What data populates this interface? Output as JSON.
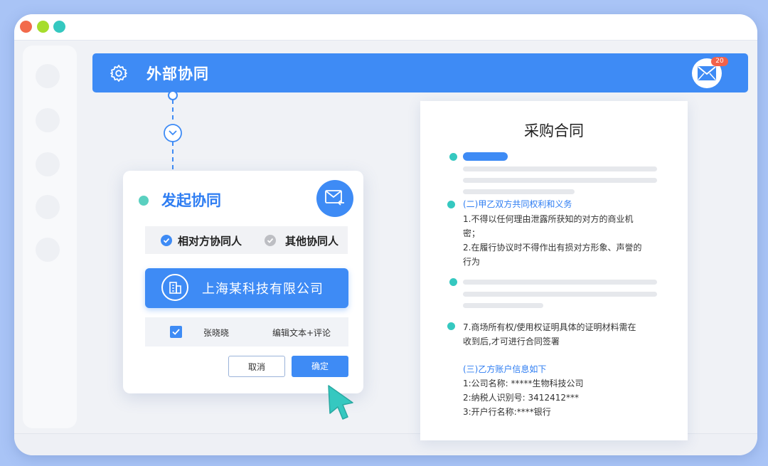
{
  "window": {
    "traffic_lights": [
      "#f26a4b",
      "#a6dd2c",
      "#35c8c0"
    ]
  },
  "topbar": {
    "title": "外部协同",
    "icon": "gear-icon",
    "mail_badge": "20"
  },
  "modal": {
    "title": "发起协同",
    "tabs": [
      {
        "label": "相对方协同人",
        "checked": true
      },
      {
        "label": "其他协同人",
        "checked": false
      }
    ],
    "company": "上海某科技有限公司",
    "member": {
      "name": "张晓晓",
      "permission": "编辑文本+评论",
      "checked": true
    },
    "cancel_label": "取消",
    "confirm_label": "确定"
  },
  "document": {
    "title": "采购合同",
    "section2_heading": "(二)甲乙双方共同权利和义务",
    "section2_line1": "1.不得以任何理由泄露所获知的对方的商业机",
    "section2_line1b": "密；",
    "section2_line2": "2.在履行协议时不得作出有损对方形象、声誉的",
    "section2_line2b": "行为",
    "item7_line1": "7.商场所有权/使用权证明具体的证明材料需在",
    "item7_line2": "收到后,才可进行合同签署",
    "section3_heading": "(三)乙方账户信息如下",
    "section3_line1": "1:公司名称: *****生物科技公司",
    "section3_line2": "2:纳税人识别号:  3412412***",
    "section3_line3": "3:开户行名称:****银行"
  },
  "colors": {
    "accent": "#3e8bf5",
    "teal": "#35c8c0",
    "background": "#a9c4f6"
  }
}
